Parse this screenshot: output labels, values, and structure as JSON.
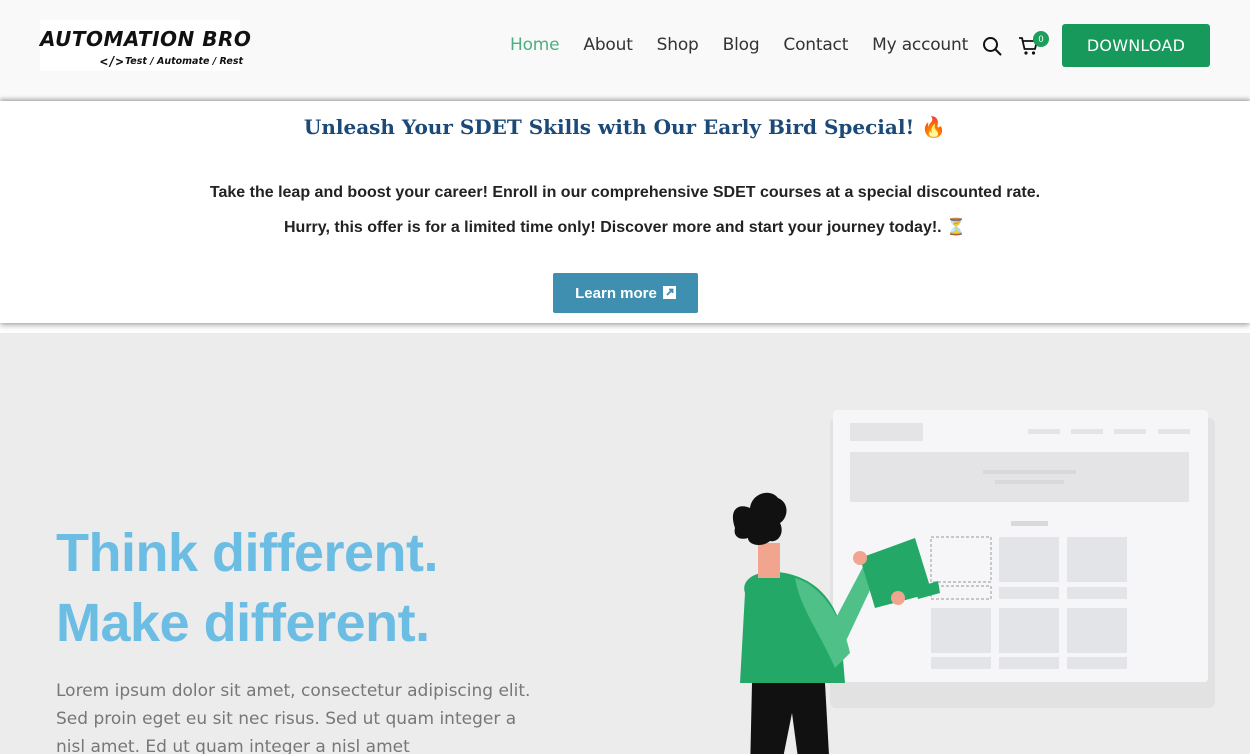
{
  "header": {
    "logo_title": "AUTOMATION BRO",
    "logo_code": "</>",
    "logo_tagline": "Test / Automate / Rest",
    "nav": [
      {
        "label": "Home",
        "active": true
      },
      {
        "label": "About",
        "active": false
      },
      {
        "label": "Shop",
        "active": false
      },
      {
        "label": "Blog",
        "active": false
      },
      {
        "label": "Contact",
        "active": false
      },
      {
        "label": "My account",
        "active": false
      }
    ],
    "cart_count": "0",
    "download_label": "DOWNLOAD",
    "colors": {
      "accent": "#16995a",
      "nav_active": "#4caf7d"
    }
  },
  "promo": {
    "title": "Unleash Your SDET Skills with Our Early Bird Special! 🔥",
    "line1": "Take the leap and boost your career! Enroll in our comprehensive SDET courses at a special discounted rate.",
    "line2": "Hurry, this offer is for a limited time only! Discover more and start your journey today!. ⏳",
    "button_label": "Learn more",
    "button_icon": "external-link-icon",
    "colors": {
      "title": "#1b4a78",
      "button": "#3f8fb1"
    }
  },
  "hero": {
    "heading_line1": "Think different.",
    "heading_line2": "Make different.",
    "paragraph": "Lorem ipsum dolor sit amet, consectetur adipiscing elit. Sed proin eget eu sit nec risus. Sed ut quam integer a nisl amet.  Ed ut quam integer a nisl amet",
    "colors": {
      "heading": "#6bbde3",
      "background": "#ececec"
    }
  }
}
